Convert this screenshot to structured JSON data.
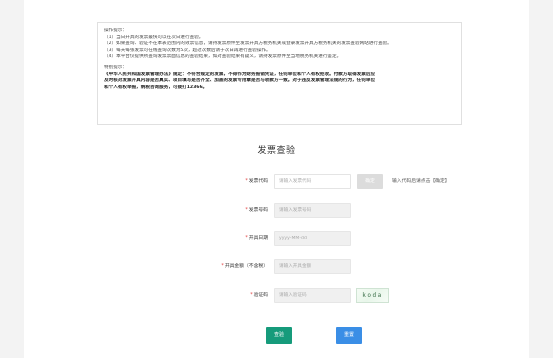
{
  "notice": {
    "heading": "操作提示：",
    "lines": [
      "（1）当日开具的发票最快可以在次日进行查验。",
      "（2）如果查询、验证不在本表范围内的效票信息，请持发票原件至发票开具方税务机关或登录发票开具方税务机关的发票查验网站进行查验。",
      "（3）每天每张发票可在线查询次数为5次，超过次数后请于次日再进行查验操作。",
      "（4）本平台仅提供所查询发票票面信息的查验结果，如对查验结果有疑义，请持发票原件至当地税务机关进行鉴定。"
    ],
    "special_heading": "特别提示：",
    "special_lines": [
      "《中华人民共和国发票管理办法》规定：不符合规定的发票，不得作为财务报销凭证，任何单位和个人有权拒收。付款方取得发票后应",
      "及时核对发票开具内容是否真实、项目填写是否齐全、加盖的发票专用章是否与收款方一致。对于违反发票管理法规的行为，任何单位",
      "和个人有权举报，纳税咨询服务，可拨打12366。"
    ]
  },
  "title": "发票查验",
  "form": {
    "invoice_code": {
      "label": "发票代码",
      "placeholder": "请输入发票代码",
      "confirm": "确定",
      "hint": "输入代码后请点击【确定】"
    },
    "invoice_number": {
      "label": "发票号码",
      "placeholder": "请输入发票号码"
    },
    "issue_date": {
      "label": "开具日期",
      "placeholder": "yyyy-MM-dd"
    },
    "amount": {
      "label": "开具金额（不含税）",
      "placeholder": "请输入开具金额"
    },
    "captcha": {
      "label": "验证码",
      "placeholder": "请输入验证码",
      "image_text": "koda"
    }
  },
  "buttons": {
    "check": "查验",
    "reset": "重置"
  },
  "colors": {
    "check": "#169b7b",
    "reset": "#3a8ee6",
    "required_star": "#e23c3c"
  }
}
